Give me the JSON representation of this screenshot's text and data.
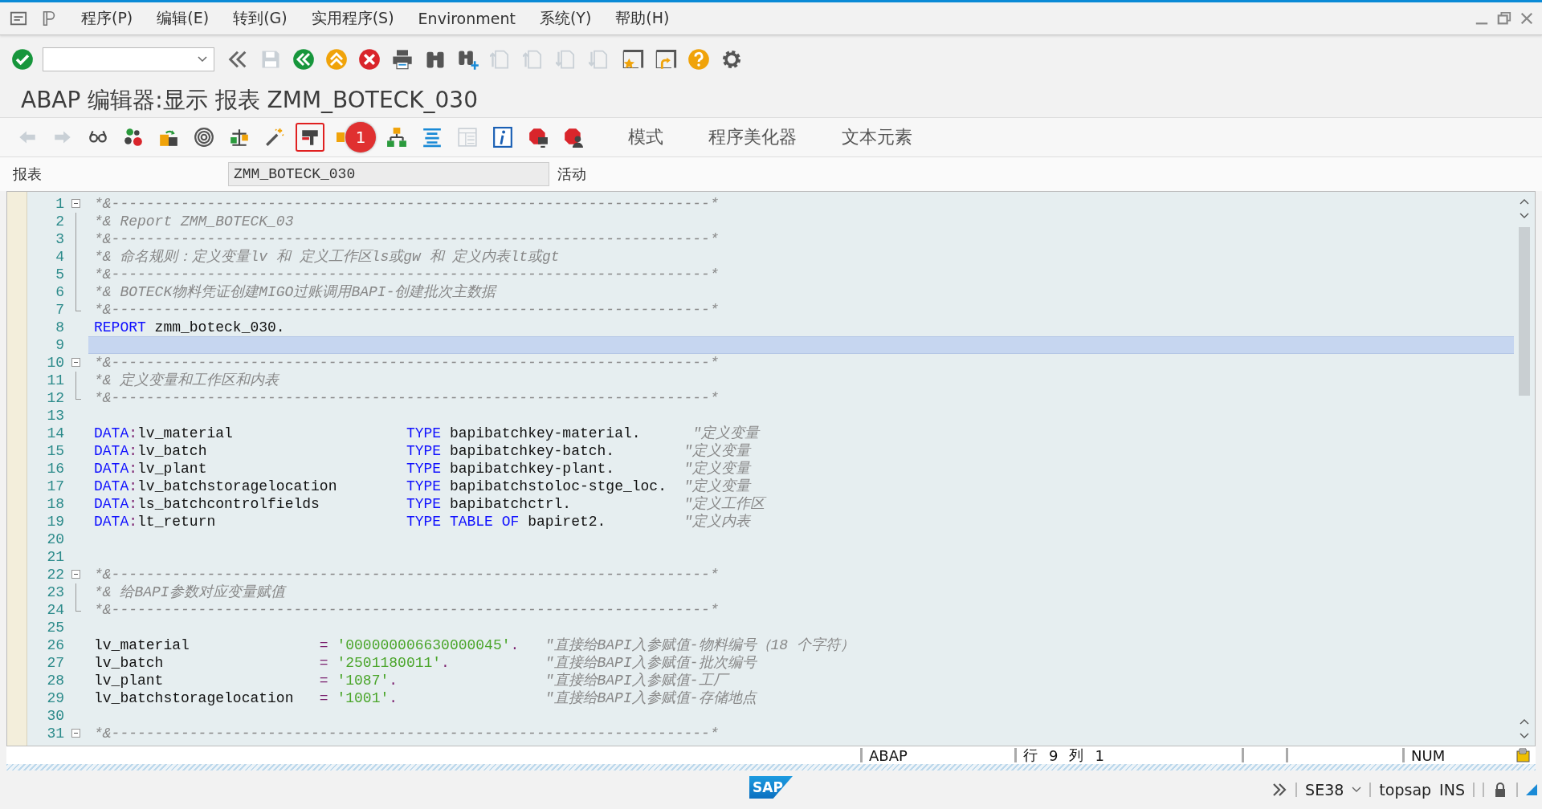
{
  "menu_bar": {
    "items": [
      "程序(P)",
      "编辑(E)",
      "转到(G)",
      "实用程序(S)",
      "Environment",
      "系统(Y)",
      "帮助(H)"
    ]
  },
  "system_toolbar": [
    {
      "kind": "check",
      "disabled": false
    },
    {
      "kind": "field"
    },
    {
      "kind": "dblleft",
      "disabled": false
    },
    {
      "kind": "save",
      "disabled": true
    },
    {
      "kind": "nav-back",
      "disabled": false
    },
    {
      "kind": "nav-exit",
      "disabled": false
    },
    {
      "kind": "nav-cancel",
      "disabled": false
    },
    {
      "kind": "print",
      "disabled": false
    },
    {
      "kind": "find",
      "disabled": false
    },
    {
      "kind": "find-next",
      "disabled": false
    },
    {
      "kind": "page-first",
      "disabled": true
    },
    {
      "kind": "page-prev",
      "disabled": true
    },
    {
      "kind": "page-next",
      "disabled": true
    },
    {
      "kind": "page-last",
      "disabled": true
    },
    {
      "kind": "new-session",
      "disabled": false
    },
    {
      "kind": "shortcut",
      "disabled": false
    },
    {
      "kind": "help",
      "disabled": false
    },
    {
      "kind": "settings",
      "disabled": false
    }
  ],
  "title": "ABAP 编辑器:显示 报表 ZMM_BOTECK_030",
  "app_toolbar": {
    "icons": [
      {
        "kind": "arrow-left",
        "disabled": true,
        "highlighted": false
      },
      {
        "kind": "arrow-right",
        "disabled": true,
        "highlighted": false
      },
      {
        "kind": "glasses",
        "disabled": false,
        "highlighted": false
      },
      {
        "kind": "objects",
        "disabled": false,
        "highlighted": false
      },
      {
        "kind": "swap",
        "disabled": false,
        "highlighted": false
      },
      {
        "kind": "spiral",
        "disabled": false,
        "highlighted": false
      },
      {
        "kind": "scale",
        "disabled": false,
        "highlighted": false
      },
      {
        "kind": "wand",
        "disabled": false,
        "highlighted": false
      },
      {
        "kind": "insert",
        "disabled": false,
        "highlighted": true
      },
      {
        "kind": "split",
        "highlighted": false,
        "badge": "1"
      },
      {
        "kind": "hierarchy",
        "disabled": false,
        "highlighted": false
      },
      {
        "kind": "align",
        "disabled": false,
        "highlighted": false
      },
      {
        "kind": "table",
        "disabled": true,
        "highlighted": false
      },
      {
        "kind": "info",
        "disabled": false,
        "highlighted": false
      },
      {
        "kind": "stop",
        "disabled": false,
        "highlighted": false
      },
      {
        "kind": "stop-user",
        "disabled": false,
        "highlighted": false
      }
    ],
    "text_buttons": [
      "模式",
      "程序美化器",
      "文本元素"
    ]
  },
  "object_row": {
    "label": "报表",
    "value": "ZMM_BOTECK_030",
    "status": "活动"
  },
  "editor": {
    "lines": [
      {
        "number": "1",
        "kind": "opener",
        "current": false,
        "segments": [
          {
            "kind": "comment",
            "text": "*&---------------------------------------------------------------------*"
          }
        ]
      },
      {
        "number": "2",
        "kind": "inner",
        "current": false,
        "segments": [
          {
            "kind": "comment",
            "text": "*& Report ZMM_BOTECK_03"
          }
        ]
      },
      {
        "number": "3",
        "kind": "inner",
        "current": false,
        "segments": [
          {
            "kind": "comment",
            "text": "*&---------------------------------------------------------------------*"
          }
        ]
      },
      {
        "number": "4",
        "kind": "inner",
        "current": false,
        "segments": [
          {
            "kind": "comment",
            "text": "*& 命名规则：定义变量lv 和 定义工作区ls或gw 和 定义内表lt或gt"
          }
        ]
      },
      {
        "number": "5",
        "kind": "inner",
        "current": false,
        "segments": [
          {
            "kind": "comment",
            "text": "*&---------------------------------------------------------------------*"
          }
        ]
      },
      {
        "number": "6",
        "kind": "inner",
        "current": false,
        "segments": [
          {
            "kind": "comment",
            "text": "*& BOTECK物料凭证创建MIGO过账调用BAPI-创建批次主数据"
          }
        ]
      },
      {
        "number": "7",
        "kind": "closer",
        "current": false,
        "segments": [
          {
            "kind": "comment",
            "text": "*&---------------------------------------------------------------------*"
          }
        ]
      },
      {
        "number": "8",
        "kind": "plain",
        "current": false,
        "segments": [
          {
            "kind": "kw",
            "text": "REPORT"
          },
          {
            "kind": "id",
            "text": " zmm_boteck_030."
          }
        ]
      },
      {
        "number": "9",
        "kind": "plain",
        "current": true
      },
      {
        "number": "10",
        "kind": "opener",
        "current": false,
        "segments": [
          {
            "kind": "comment",
            "text": "*&---------------------------------------------------------------------*"
          }
        ]
      },
      {
        "number": "11",
        "kind": "inner",
        "current": false,
        "segments": [
          {
            "kind": "comment",
            "text": "*& 定义变量和工作区和内表"
          }
        ]
      },
      {
        "number": "12",
        "kind": "closer",
        "current": false,
        "segments": [
          {
            "kind": "comment",
            "text": "*&---------------------------------------------------------------------*"
          }
        ]
      },
      {
        "number": "13",
        "kind": "plain",
        "current": false
      },
      {
        "number": "14",
        "kind": "plain",
        "current": false,
        "segments": [
          {
            "kind": "kw",
            "text": "DATA"
          },
          {
            "kind": "op",
            "text": ":"
          },
          {
            "kind": "id",
            "text": "lv_material                    "
          },
          {
            "kind": "kw",
            "text": "TYPE"
          },
          {
            "kind": "id",
            "text": " bapibatchkey-material.      "
          },
          {
            "kind": "comment",
            "text": "\"定义变量"
          }
        ]
      },
      {
        "number": "15",
        "kind": "plain",
        "current": false,
        "segments": [
          {
            "kind": "kw",
            "text": "DATA"
          },
          {
            "kind": "op",
            "text": ":"
          },
          {
            "kind": "id",
            "text": "lv_batch                       "
          },
          {
            "kind": "kw",
            "text": "TYPE"
          },
          {
            "kind": "id",
            "text": " bapibatchkey-batch.        "
          },
          {
            "kind": "comment",
            "text": "\"定义变量"
          }
        ]
      },
      {
        "number": "16",
        "kind": "plain",
        "current": false,
        "segments": [
          {
            "kind": "kw",
            "text": "DATA"
          },
          {
            "kind": "op",
            "text": ":"
          },
          {
            "kind": "id",
            "text": "lv_plant                       "
          },
          {
            "kind": "kw",
            "text": "TYPE"
          },
          {
            "kind": "id",
            "text": " bapibatchkey-plant.        "
          },
          {
            "kind": "comment",
            "text": "\"定义变量"
          }
        ]
      },
      {
        "number": "17",
        "kind": "plain",
        "current": false,
        "segments": [
          {
            "kind": "kw",
            "text": "DATA"
          },
          {
            "kind": "op",
            "text": ":"
          },
          {
            "kind": "id",
            "text": "lv_batchstoragelocation        "
          },
          {
            "kind": "kw",
            "text": "TYPE"
          },
          {
            "kind": "id",
            "text": " bapibatchstoloc-stge_loc.  "
          },
          {
            "kind": "comment",
            "text": "\"定义变量"
          }
        ]
      },
      {
        "number": "18",
        "kind": "plain",
        "current": false,
        "segments": [
          {
            "kind": "kw",
            "text": "DATA"
          },
          {
            "kind": "op",
            "text": ":"
          },
          {
            "kind": "id",
            "text": "ls_batchcontrolfields          "
          },
          {
            "kind": "kw",
            "text": "TYPE"
          },
          {
            "kind": "id",
            "text": " bapibatchctrl.             "
          },
          {
            "kind": "comment",
            "text": "\"定义工作区"
          }
        ]
      },
      {
        "number": "19",
        "kind": "plain",
        "current": false,
        "segments": [
          {
            "kind": "kw",
            "text": "DATA"
          },
          {
            "kind": "op",
            "text": ":"
          },
          {
            "kind": "id",
            "text": "lt_return                      "
          },
          {
            "kind": "kw",
            "text": "TYPE TABLE OF"
          },
          {
            "kind": "id",
            "text": " bapiret2.         "
          },
          {
            "kind": "comment",
            "text": "\"定义内表"
          }
        ]
      },
      {
        "number": "20",
        "kind": "plain",
        "current": false
      },
      {
        "number": "21",
        "kind": "plain",
        "current": false
      },
      {
        "number": "22",
        "kind": "opener",
        "current": false,
        "segments": [
          {
            "kind": "comment",
            "text": "*&---------------------------------------------------------------------*"
          }
        ]
      },
      {
        "number": "23",
        "kind": "inner",
        "current": false,
        "segments": [
          {
            "kind": "comment",
            "text": "*& 给BAPI参数对应变量赋值"
          }
        ]
      },
      {
        "number": "24",
        "kind": "closer",
        "current": false,
        "segments": [
          {
            "kind": "comment",
            "text": "*&---------------------------------------------------------------------*"
          }
        ]
      },
      {
        "number": "25",
        "kind": "plain",
        "current": false
      },
      {
        "number": "26",
        "kind": "plain",
        "current": false,
        "segments": [
          {
            "kind": "id",
            "text": "lv_material               "
          },
          {
            "kind": "op",
            "text": "= "
          },
          {
            "kind": "str",
            "text": "'000000006630000045'"
          },
          {
            "kind": "op",
            "text": ".   "
          },
          {
            "kind": "comment",
            "text": "\"直接给BAPI入参赋值-物料编号（18 个字符）"
          }
        ]
      },
      {
        "number": "27",
        "kind": "plain",
        "current": false,
        "segments": [
          {
            "kind": "id",
            "text": "lv_batch                  "
          },
          {
            "kind": "op",
            "text": "= "
          },
          {
            "kind": "str",
            "text": "'2501180011'"
          },
          {
            "kind": "op",
            "text": ".           "
          },
          {
            "kind": "comment",
            "text": "\"直接给BAPI入参赋值-批次编号"
          }
        ]
      },
      {
        "number": "28",
        "kind": "plain",
        "current": false,
        "segments": [
          {
            "kind": "id",
            "text": "lv_plant                  "
          },
          {
            "kind": "op",
            "text": "= "
          },
          {
            "kind": "str",
            "text": "'1087'"
          },
          {
            "kind": "op",
            "text": ".                 "
          },
          {
            "kind": "comment",
            "text": "\"直接给BAPI入参赋值-工厂"
          }
        ]
      },
      {
        "number": "29",
        "kind": "plain",
        "current": false,
        "segments": [
          {
            "kind": "id",
            "text": "lv_batchstoragelocation   "
          },
          {
            "kind": "op",
            "text": "= "
          },
          {
            "kind": "str",
            "text": "'1001'"
          },
          {
            "kind": "op",
            "text": ".                 "
          },
          {
            "kind": "comment",
            "text": "\"直接给BAPI入参赋值-存储地点"
          }
        ]
      },
      {
        "number": "30",
        "kind": "plain",
        "current": false
      },
      {
        "number": "31",
        "kind": "opener",
        "current": false,
        "segments": [
          {
            "kind": "comment",
            "text": "*&---------------------------------------------------------------------*"
          }
        ]
      }
    ]
  },
  "status_bar": {
    "language": "ABAP",
    "row_label": "行",
    "row": "9",
    "col_label": "列",
    "col": "1",
    "num": "NUM"
  },
  "bottom_bar": {
    "logo": "SAP",
    "transaction": "SE38",
    "server": "topsap",
    "mode": "INS"
  }
}
